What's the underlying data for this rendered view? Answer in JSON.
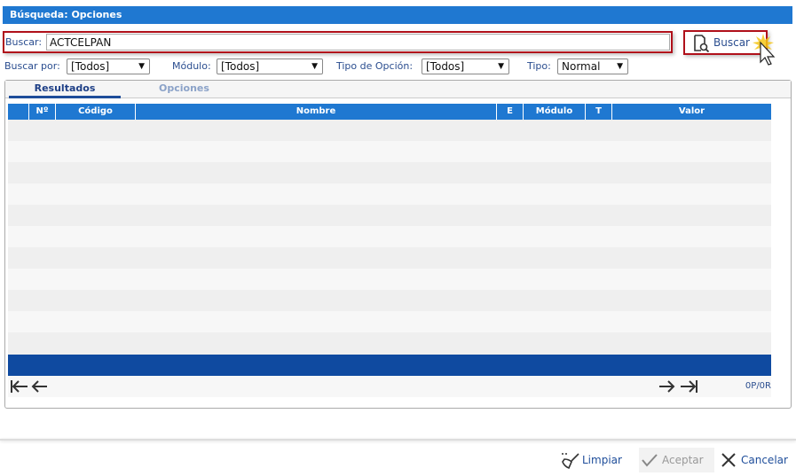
{
  "title": "Búsqueda: Opciones",
  "search": {
    "label": "Buscar:",
    "value": "ACTCELPAN",
    "button": "Buscar"
  },
  "filters": {
    "buscar_por": {
      "label": "Buscar por:",
      "value": "[Todos]"
    },
    "modulo": {
      "label": "Módulo:",
      "value": "[Todos]"
    },
    "tipo_opcion": {
      "label": "Tipo de Opción:",
      "value": "[Todos]"
    },
    "tipo": {
      "label": "Tipo:",
      "value": "Normal"
    }
  },
  "tabs": [
    {
      "label": "Resultados",
      "active": true
    },
    {
      "label": "Opciones",
      "active": false
    }
  ],
  "table": {
    "columns": [
      "",
      "Nº",
      "Código",
      "Nombre",
      "E",
      "Módulo",
      "T",
      "Valor"
    ],
    "rows": []
  },
  "pager": {
    "info": "0P/0R"
  },
  "footer": {
    "limpiar": "Limpiar",
    "aceptar": "Aceptar",
    "cancelar": "Cancelar"
  },
  "colors": {
    "header": "#1f78d1",
    "highlight": "#b0101a",
    "table_footer": "#0f4aa0"
  }
}
